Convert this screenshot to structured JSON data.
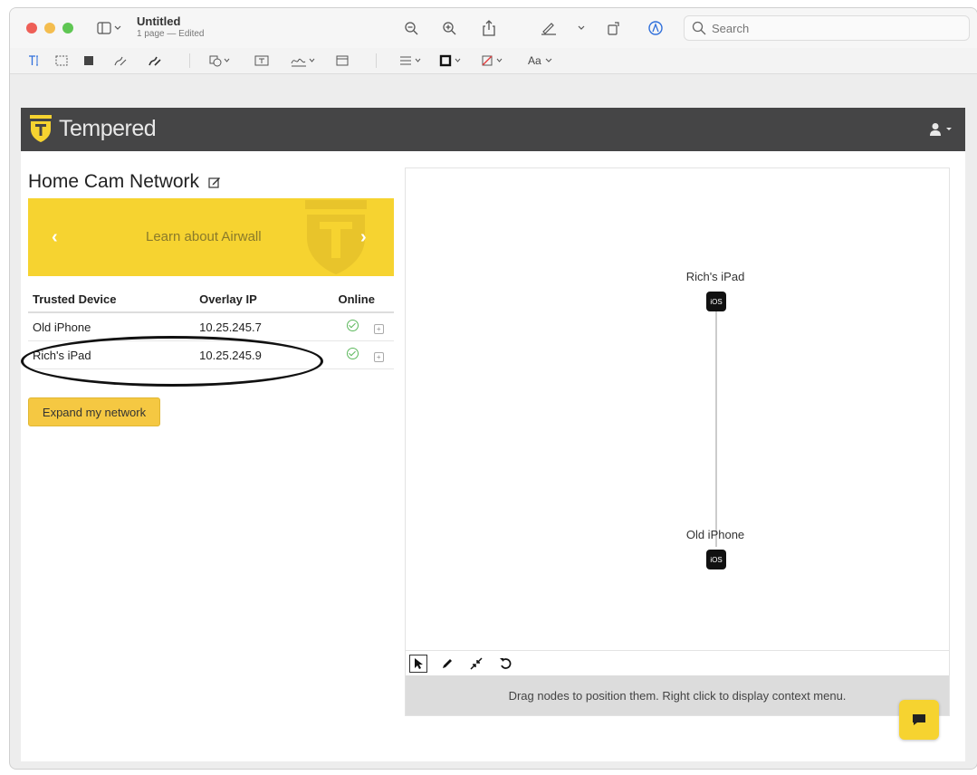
{
  "window": {
    "doc_title": "Untitled",
    "doc_subtitle": "1 page — Edited",
    "search_placeholder": "Search"
  },
  "markup_toolbar": {
    "font_label": "Aa"
  },
  "app": {
    "brand": "Tempered",
    "network_title": "Home Cam Network",
    "banner_text": "Learn about Airwall",
    "table": {
      "headers": [
        "Trusted Device",
        "Overlay IP",
        "Online"
      ],
      "rows": [
        {
          "device": "Old iPhone",
          "ip": "10.25.245.7",
          "online": true
        },
        {
          "device": "Rich's iPad",
          "ip": "10.25.245.9",
          "online": true
        }
      ]
    },
    "expand_button": "Expand my network",
    "graph": {
      "nodes": [
        {
          "label": "Rich's iPad",
          "os": "iOS"
        },
        {
          "label": "Old iPhone",
          "os": "iOS"
        }
      ],
      "hint": "Drag nodes to position them. Right click to display context menu."
    }
  },
  "colors": {
    "brand_yellow": "#f6d330",
    "header_bg": "#454546",
    "online_green": "#5cb85c"
  }
}
